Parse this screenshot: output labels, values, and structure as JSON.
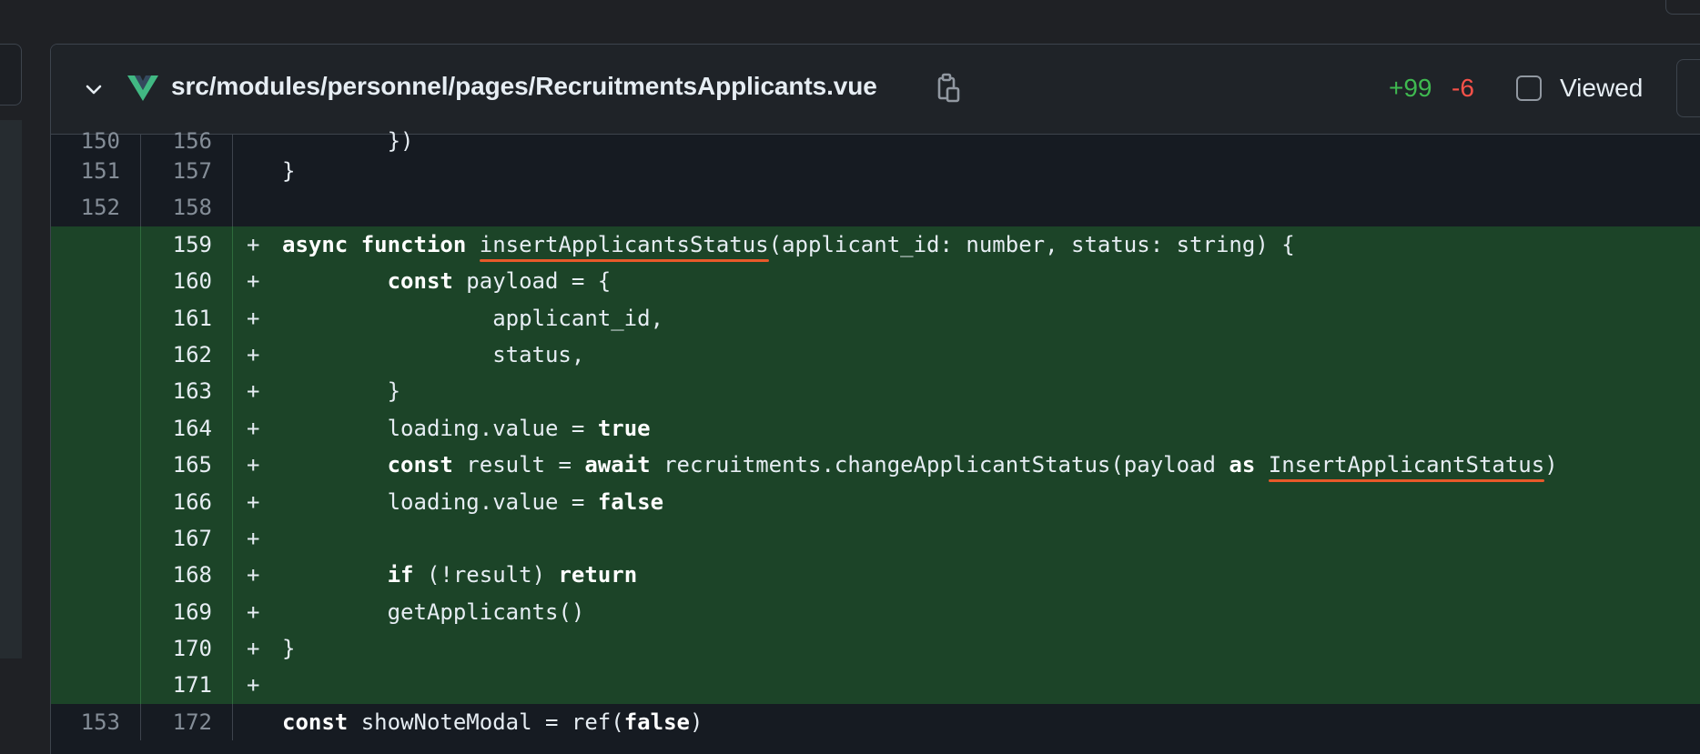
{
  "file": {
    "path": "src/modules/personnel/pages/RecruitmentsApplicants.vue",
    "additions": "+99",
    "deletions": "-6",
    "viewed_label": "Viewed",
    "icons": {
      "collapse": "chevron-down-icon",
      "file_type": "vue-logo-icon",
      "copy": "copy-path-icon"
    },
    "colors": {
      "additions": "#3fb950",
      "deletions": "#f85149",
      "added_line_bg": "#1c4428",
      "squiggle": "#e8592a",
      "vue_green": "#41b883"
    }
  },
  "diff": {
    "lines": [
      {
        "old": "150",
        "new": "156",
        "marker": "",
        "code": "        })"
      },
      {
        "old": "151",
        "new": "157",
        "marker": "",
        "code": "}"
      },
      {
        "old": "152",
        "new": "158",
        "marker": "",
        "code": ""
      },
      {
        "old": "",
        "new": "159",
        "marker": "+",
        "code": "async function insertApplicantsStatus(applicant_id: number, status: string) {"
      },
      {
        "old": "",
        "new": "160",
        "marker": "+",
        "code": "        const payload = {"
      },
      {
        "old": "",
        "new": "161",
        "marker": "+",
        "code": "                applicant_id,"
      },
      {
        "old": "",
        "new": "162",
        "marker": "+",
        "code": "                status,"
      },
      {
        "old": "",
        "new": "163",
        "marker": "+",
        "code": "        }"
      },
      {
        "old": "",
        "new": "164",
        "marker": "+",
        "code": "        loading.value = true"
      },
      {
        "old": "",
        "new": "165",
        "marker": "+",
        "code": "        const result = await recruitments.changeApplicantStatus(payload as InsertApplicantStatus)"
      },
      {
        "old": "",
        "new": "166",
        "marker": "+",
        "code": "        loading.value = false"
      },
      {
        "old": "",
        "new": "167",
        "marker": "+",
        "code": ""
      },
      {
        "old": "",
        "new": "168",
        "marker": "+",
        "code": "        if (!result) return"
      },
      {
        "old": "",
        "new": "169",
        "marker": "+",
        "code": "        getApplicants()"
      },
      {
        "old": "",
        "new": "170",
        "marker": "+",
        "code": "}"
      },
      {
        "old": "",
        "new": "171",
        "marker": "+",
        "code": ""
      },
      {
        "old": "153",
        "new": "172",
        "marker": "",
        "code": "const showNoteModal = ref(false)"
      }
    ],
    "highlighted_identifiers": [
      "insertApplicantsStatus",
      "InsertApplicantStatus"
    ]
  }
}
